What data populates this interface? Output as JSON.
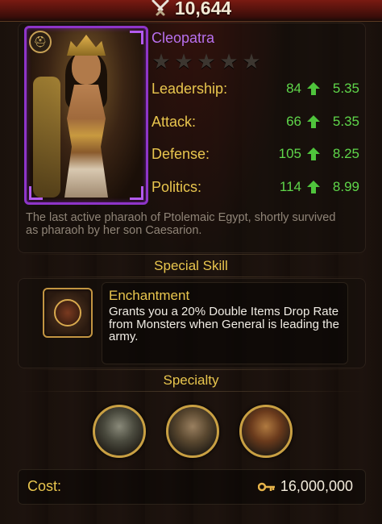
{
  "header": {
    "power_value": "10,644",
    "power_icon": "crossed-swords-icon"
  },
  "general": {
    "name": "Cleopatra",
    "stars_total": 5,
    "stars_filled": 0,
    "stats": [
      {
        "label": "Leadership:",
        "value": "84",
        "bonus": "5.35"
      },
      {
        "label": "Attack:",
        "value": "66",
        "bonus": "5.35"
      },
      {
        "label": "Defense:",
        "value": "105",
        "bonus": "8.25"
      },
      {
        "label": "Politics:",
        "value": "114",
        "bonus": "8.99"
      }
    ],
    "description": "The last active pharaoh of Ptolemaic Egypt, shortly survived as pharaoh by her son Caesarion."
  },
  "special_skill": {
    "heading": "Special Skill",
    "name": "Enchantment",
    "description": "Grants you a 20% Double Items Drop Rate from Monsters when General is leading the army."
  },
  "specialty": {
    "heading": "Specialty",
    "items": [
      "infantry-icon",
      "cavalry-icon",
      "ranged-icon"
    ]
  },
  "cost": {
    "label": "Cost:",
    "value": "16,000,000",
    "icon": "key-icon"
  },
  "colors": {
    "stat_label": "#e9c64e",
    "stat_value": "#5fd64a",
    "name": "#b870ee",
    "frame": "#8e35c9"
  }
}
